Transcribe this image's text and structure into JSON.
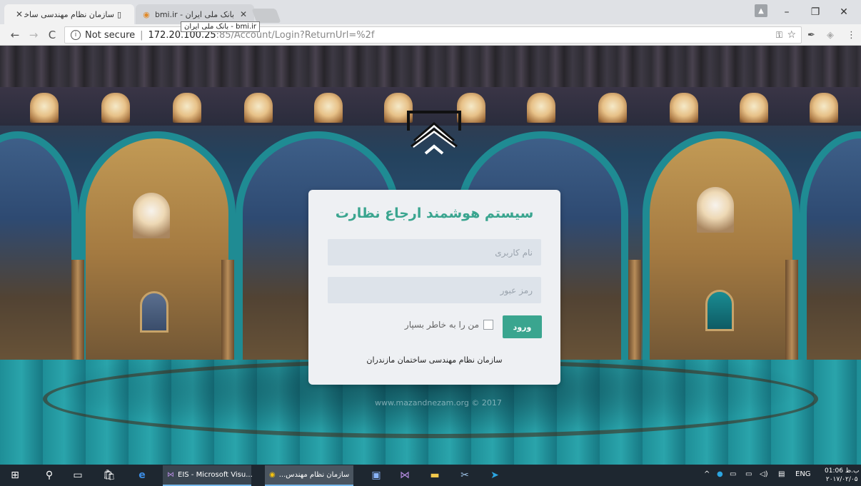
{
  "browser": {
    "tabs": [
      {
        "title": "سازمان نظام مهندسی ساختمان",
        "active": true,
        "icon": "document-icon"
      },
      {
        "title": "بانک ملی ایران - bmi.ir",
        "active": false,
        "icon": "bmi-icon"
      }
    ],
    "tooltip": "بانک ملی ایران - bmi.ir",
    "address": {
      "security_label": "Not secure",
      "host": "172.20.100.25",
      "path": ":85/Account/Login?ReturnUrl=%2f"
    }
  },
  "login": {
    "title": "سیستم هوشمند ارجاع نظارت",
    "username_placeholder": "نام کاربری",
    "password_placeholder": "رمز عبور",
    "submit_label": "ورود",
    "remember_label": "من را به خاطر بسپار",
    "footer": "سازمان نظام مهندسی ساختمان مازندران",
    "accent_color": "#3aa58f"
  },
  "watermark": "www.mazandnezam.org © 2017",
  "taskbar": {
    "apps": [
      {
        "label": "EIS - Microsoft Visu...",
        "icon": "visual-studio-icon"
      },
      {
        "label": "...سازمان نظام مهندس",
        "icon": "chrome-icon"
      }
    ],
    "language": "ENG",
    "time": "01:06 ب.ظ",
    "date": "۲۰۱۷/۰۲/۰۵"
  }
}
